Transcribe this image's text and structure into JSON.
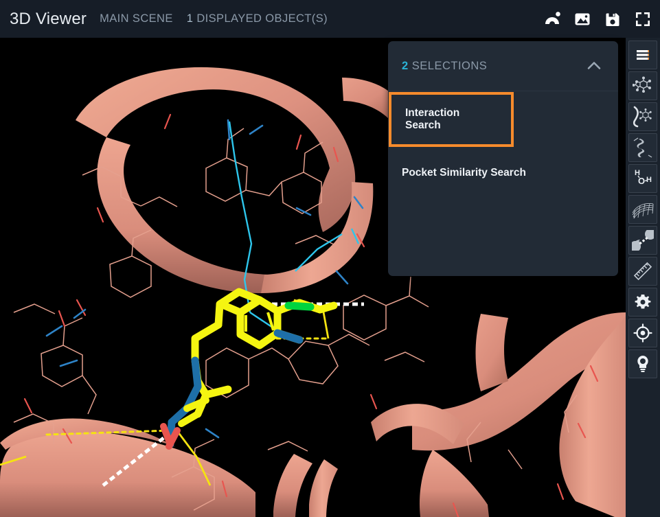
{
  "header": {
    "app_title": "3D Viewer",
    "scene_name": "MAIN SCENE",
    "object_count_number": "1",
    "object_count_label": "DISPLAYED OBJECT(S)",
    "actions": [
      {
        "name": "magnet-icon",
        "label": "Magnet"
      },
      {
        "name": "image-icon",
        "label": "Screenshot"
      },
      {
        "name": "save-icon",
        "label": "Save"
      },
      {
        "name": "fullscreen-icon",
        "label": "Fullscreen"
      }
    ]
  },
  "selections_panel": {
    "count": "2",
    "title": "SELECTIONS",
    "collapse_icon": "chevron-up-icon",
    "items": [
      {
        "label": "Interaction Search",
        "highlighted": true
      },
      {
        "label": "Pocket Similarity Search",
        "highlighted": false
      }
    ]
  },
  "tool_sidebar": {
    "items": [
      {
        "name": "menu-icon",
        "label": "Menu"
      },
      {
        "name": "molecule-icon",
        "label": "Ligand"
      },
      {
        "name": "pocket-icon",
        "label": "Binding Site"
      },
      {
        "name": "helix-icon",
        "label": "Secondary Structure"
      },
      {
        "name": "water-icon",
        "label": "Water"
      },
      {
        "name": "surface-icon",
        "label": "Surface"
      },
      {
        "name": "interaction-icon",
        "label": "Interactions"
      },
      {
        "name": "ruler-icon",
        "label": "Measure"
      },
      {
        "name": "gear-icon",
        "label": "Settings"
      },
      {
        "name": "target-icon",
        "label": "Center"
      },
      {
        "name": "bulb-icon",
        "label": "Lighting"
      }
    ]
  },
  "colors": {
    "header_bg": "#161d27",
    "panel_bg": "#222b36",
    "sidebar_bg": "#1a222c",
    "accent_orange": "#f68b2c",
    "accent_cyan": "#2bb3d6",
    "muted_text": "#8b99a8",
    "ribbon_salmon": "#e39180",
    "ligand_yellow": "#f5f511",
    "heteroatom_blue": "#1e6fa8",
    "halogen_green": "#00d43f",
    "oxygen_red": "#e8554f"
  },
  "scene": {
    "description": "Protein binding site with salmon cartoon ribbons, thin salmon residue sticks, a yellow-carbon ligand with blue nitrogen and green halogen, plus yellow dashed, white dashed and cyan contact lines."
  }
}
